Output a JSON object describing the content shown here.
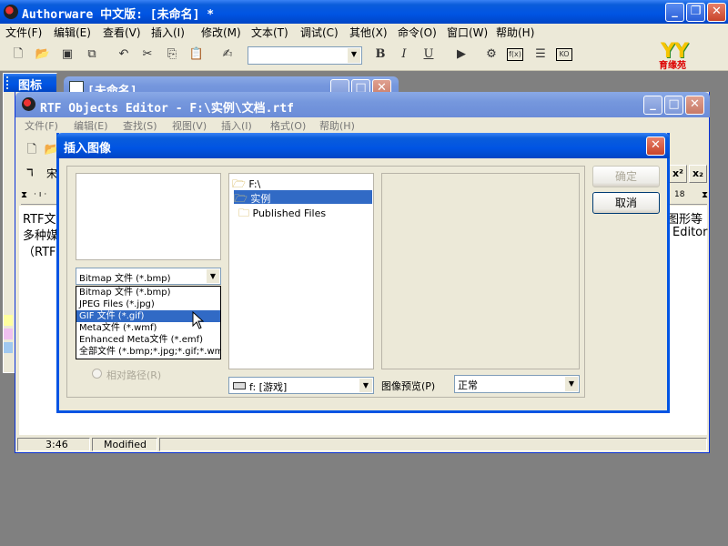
{
  "app": {
    "title": "Authorware 中文版: [未命名] *",
    "menu": [
      "文件(F)",
      "编辑(E)",
      "查看(V)",
      "插入(I)",
      "修改(M)",
      "文本(T)",
      "调试(C)",
      "其他(X)",
      "命令(O)",
      "窗口(W)",
      "帮助(H)"
    ],
    "logo_text": "育缘苑",
    "logo_letters": "YY",
    "icons_panel_title": "图标"
  },
  "child_window": {
    "title": "[未命名]"
  },
  "rtf_editor": {
    "title": "RTF Objects Editor - F:\\实例\\文档.rtf",
    "menu": [
      "文件(F)",
      "编辑(E)",
      "查找(S)",
      "视图(V)",
      "插入(I)",
      "格式(O)",
      "帮助(H)"
    ],
    "font_name": "宋",
    "left_text": [
      "RTF文",
      "多种媒",
      "（RTF"
    ],
    "right_text": [
      "图形等",
      "Editor"
    ],
    "ruler_mark": "18",
    "superscript": "x²",
    "subscript": "x₂",
    "status": {
      "position": "3:46",
      "state": "Modified"
    }
  },
  "dialog": {
    "title": "插入图像",
    "ok_label": "确定",
    "cancel_label": "取消",
    "file_type_selected": "Bitmap 文件 (*.bmp)",
    "file_type_options": [
      "Bitmap 文件 (*.bmp)",
      "JPEG Files (*.jpg)",
      "GIF 文件 (*.gif)",
      "Meta文件 (*.wmf)",
      "Enhanced Meta文件 (*.emf)",
      "全部文件 (*.bmp;*.jpg;*.gif;*.wmf"
    ],
    "file_type_highlighted_index": 2,
    "relative_path_label": "相对路径(R)",
    "folders": [
      "F:\\",
      "实例",
      "Published Files"
    ],
    "drive_label": "f: [游戏]",
    "preview_label": "图像预览(P)",
    "preview_mode": "正常"
  }
}
